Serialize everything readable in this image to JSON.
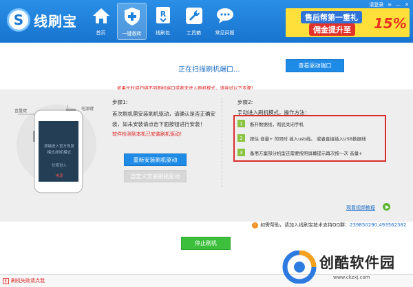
{
  "app": {
    "logo_letter": "S",
    "name": "线刷宝"
  },
  "nav": [
    {
      "label": "首页",
      "icon": "home-icon",
      "active": false
    },
    {
      "label": "一键救砖",
      "icon": "shield-plus-icon",
      "active": true
    },
    {
      "label": "线刷包",
      "icon": "rom-package-icon",
      "active": false
    },
    {
      "label": "工具箱",
      "icon": "wrench-icon",
      "active": false
    },
    {
      "label": "常见问题",
      "icon": "faq-chat-icon",
      "active": false
    }
  ],
  "window": {
    "login": "请登录",
    "menu": "≡",
    "minimize": "—",
    "close": "✕"
  },
  "ad": {
    "line1": "售后帮第一重礼",
    "line2": "佣金提升至",
    "percent": "15%"
  },
  "scan": {
    "status": "正在扫描刷机端口...",
    "view_port_button": "查看驱动端口",
    "warning": "如果长时间扫描不到刷机端口或者未进入刷机模式，请尝试以下步骤！"
  },
  "phone": {
    "volume_label": "音量键",
    "power_label": "电源键",
    "screen_lines": [
      "按键进入官方恢复",
      "模式/刷机模式"
    ],
    "screen_sub": "长按进入",
    "screen_hint": "电源"
  },
  "step1": {
    "title": "步骤1:",
    "text": "首次刷机需安装刷机驱动，请确认是否正确安装，如未安装请点击下面按钮进行安装！",
    "detected": "软件检测到本机已安装刷机驱动！",
    "reinstall_button": "重新安装刷机驱动",
    "custom_button": "自定义安装刷机驱动"
  },
  "step2": {
    "title": "步骤2:",
    "subtitle": "手动进入刷机模式，操作方法：",
    "items": [
      {
        "num": "1",
        "text": "断开数据线，彻底关闭手机"
      },
      {
        "num": "2",
        "text": "按住 音量+   的同时  插入usb线。  或者直接插入USB数据线"
      },
      {
        "num": "3",
        "text": "备用方案部分机型还需要按照屏幕提示再次按一次 音量+"
      }
    ]
  },
  "video_link": "观看视频教程",
  "help": {
    "prefix": "如需帮助，请加入线刷宝技术支持QQ群：",
    "groups": "239850290,493562382"
  },
  "stop_button": "停止刷机",
  "status_bar": {
    "text": "刷机失败请点我"
  },
  "watermark": {
    "title": "创酷软件园",
    "url": "www.ckzxj.com"
  },
  "colors": {
    "topbar": "#1e82dc",
    "accent_blue": "#1e8be6",
    "danger": "#e02020",
    "success": "#3cc03c",
    "step_green": "#8bc440"
  }
}
